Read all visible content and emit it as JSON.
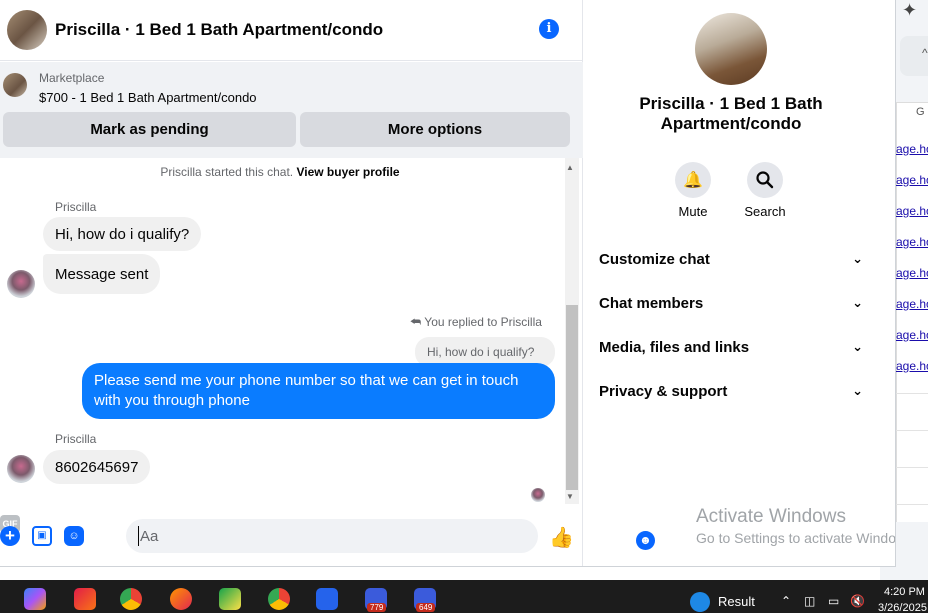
{
  "chat": {
    "header": {
      "title": "Priscilla · 1 Bed 1 Bath Apartment/condo",
      "info_icon": "info-icon"
    },
    "listing": {
      "kicker": "Marketplace",
      "name": "$700 - 1 Bed 1 Bath Apartment/condo",
      "mark_pending_label": "Mark as pending",
      "more_options_label": "More options"
    },
    "started_text": "Priscilla started this chat.",
    "view_profile_link": "View buyer profile",
    "messages": [
      {
        "sender": "Priscilla",
        "text": "Hi, how do i qualify?"
      },
      {
        "text": "Message sent"
      },
      {
        "reply_label": "You replied to Priscilla",
        "quoted": "Hi, how do i qualify?",
        "text": "Please send me your phone  number so that we can get in touch with you through phone"
      },
      {
        "sender": "Priscilla",
        "text": "8602645697"
      }
    ],
    "composer": {
      "placeholder": "Aa",
      "gif_label": "GIF",
      "icons": [
        "add-icon",
        "photo-icon",
        "sticker-icon",
        "gif-icon",
        "emoji-icon",
        "like-icon"
      ]
    }
  },
  "details": {
    "name": "Priscilla · 1 Bed 1 Bath Apartment/condo",
    "actions": [
      {
        "label": "Mute",
        "icon": "bell-icon"
      },
      {
        "label": "Search",
        "icon": "search-icon"
      }
    ],
    "sections": [
      "Customize chat",
      "Chat members",
      "Media, files and links",
      "Privacy & support"
    ],
    "watermark_title": "Activate Windows",
    "watermark_sub": "Go to Settings to activate Windows."
  },
  "background_page": {
    "column_head": "G",
    "links": [
      "age.ho",
      "age.ho",
      "age.ho",
      "age.ho",
      "age.ho",
      "age.ho",
      "age.ho",
      "age.ho"
    ]
  },
  "taskbar": {
    "badges": [
      "779",
      "649"
    ],
    "result_label": "Result",
    "time": "4:20 PM",
    "date": "3/26/2025"
  },
  "colors": {
    "accent": "#0866ff",
    "outgoing_bubble": "#0a7cff",
    "incoming_bubble": "#f0f0f0",
    "listing_bg": "#f0f2f5"
  }
}
